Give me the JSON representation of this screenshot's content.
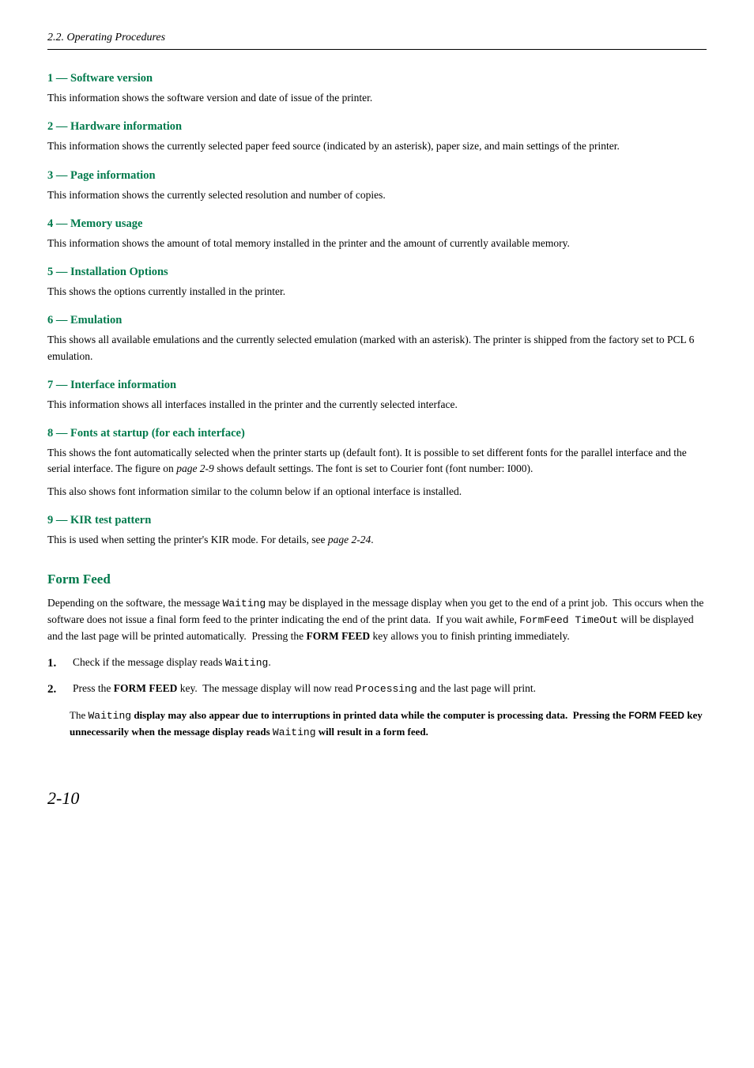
{
  "header": {
    "title": "2.2. Operating Procedures"
  },
  "sections": [
    {
      "id": "s1",
      "heading": "1 — Software version",
      "body": "This information shows the software version and date of issue of the printer."
    },
    {
      "id": "s2",
      "heading": "2 — Hardware information",
      "body": "This information shows the currently selected paper feed source (indicated by an asterisk), paper size, and main settings of the printer."
    },
    {
      "id": "s3",
      "heading": "3 — Page information",
      "body": "This information shows the currently selected resolution and number of copies."
    },
    {
      "id": "s4",
      "heading": "4 — Memory usage",
      "body": "This information shows the amount of total memory installed in the printer and the amount of currently available memory."
    },
    {
      "id": "s5",
      "heading": "5 — Installation Options",
      "body": "This shows the options currently installed in the printer."
    },
    {
      "id": "s6",
      "heading": "6 — Emulation",
      "body": "This shows all available emulations and the currently selected emulation (marked with an asterisk). The printer is shipped from the factory set to PCL 6 emulation."
    },
    {
      "id": "s7",
      "heading": "7 — Interface information",
      "body": "This information shows all interfaces installed in the printer and the currently selected interface."
    },
    {
      "id": "s8",
      "heading": "8 — Fonts at startup (for each interface)",
      "body1": "This shows the font automatically selected when the printer starts up (default font). It is possible to set different fonts for the parallel interface and the serial interface. The figure on page 2-9 shows default settings. The font is set to Courier font (font number: I000).",
      "body2": "This also shows font information similar to the column below if an optional interface is installed."
    },
    {
      "id": "s9",
      "heading": "9 — KIR test pattern",
      "body": "This is used when setting the printer's KIR mode. For details, see page 2-24."
    }
  ],
  "form_feed": {
    "heading": "Form Feed",
    "intro": "Depending on the software, the message Waiting may be displayed in the message display when you get to the end of a print job.  This occurs when the software does not issue a final form feed to the printer indicating the end of the print data.  If you wait awhile, FormFeed TimeOut will be displayed and the last page will be printed automatically.  Pressing the FORM FEED key allows you to finish printing immediately.",
    "steps": [
      {
        "num": "1.",
        "text_before": "Check if the message display reads ",
        "mono": "Waiting",
        "text_after": "."
      },
      {
        "num": "2.",
        "text_before": "Press the ",
        "bold": "FORM FEED",
        "text_mid": " key.  The message display will now read ",
        "mono": "Processing",
        "text_after": " and the last page will print."
      }
    ],
    "note": "The Waiting display may also appear due to interruptions in printed data while the computer is processing data.  Pressing the FORM FEED key unnecessarily when the message display reads Waiting will result in a form feed."
  },
  "page_number": "2-10"
}
